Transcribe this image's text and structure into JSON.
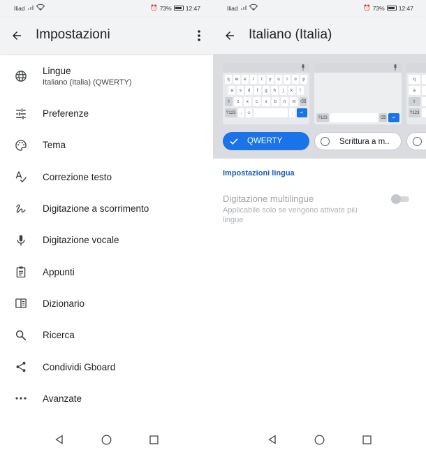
{
  "status_bar": {
    "carrier": "Iliad",
    "battery": "73%",
    "time": "12:47"
  },
  "left_screen": {
    "title": "Impostazioni",
    "menu": [
      {
        "label": "Lingue",
        "sub": "Italiano (Italia) (QWERTY)",
        "icon": "globe-icon"
      },
      {
        "label": "Preferenze",
        "icon": "sliders-icon"
      },
      {
        "label": "Tema",
        "icon": "palette-icon"
      },
      {
        "label": "Correzione testo",
        "icon": "spellcheck-icon"
      },
      {
        "label": "Digitazione a scorrimento",
        "icon": "gesture-icon"
      },
      {
        "label": "Digitazione vocale",
        "icon": "mic-icon"
      },
      {
        "label": "Appunti",
        "icon": "clipboard-icon"
      },
      {
        "label": "Dizionario",
        "icon": "dictionary-icon"
      },
      {
        "label": "Ricerca",
        "icon": "search-icon"
      },
      {
        "label": "Condividi Gboard",
        "icon": "share-icon"
      },
      {
        "label": "Avanzate",
        "icon": "more-horizontal-icon"
      }
    ]
  },
  "right_screen": {
    "title": "Italiano (Italia)",
    "layouts": [
      {
        "label": "QWERTY",
        "selected": true
      },
      {
        "label": "Scrittura a m..",
        "selected": false
      }
    ],
    "keyboard_preview": {
      "row1": [
        "q",
        "w",
        "e",
        "r",
        "t",
        "y",
        "u",
        "i",
        "o",
        "p"
      ],
      "row2": [
        "a",
        "s",
        "d",
        "f",
        "g",
        "h",
        "j",
        "k",
        "l"
      ],
      "row3": [
        "⇧",
        "z",
        "x",
        "c",
        "v",
        "b",
        "n",
        "m",
        "⌫"
      ],
      "row4_left": "?123",
      "row4_comma": ",",
      "row4_dot": ".",
      "enter": "↵"
    },
    "handwriting_preview": {
      "symbols_key": "?123",
      "enter": "↵"
    },
    "section_title": "Impostazioni lingua",
    "multilingual": {
      "title": "Digitazione multilingue",
      "subtitle": "Applicabile solo se vengono attivate più lingue",
      "enabled": false
    }
  },
  "colors": {
    "accent": "#1a73e8",
    "section_title": "#1a5fb4",
    "app_bar": "#f1f3f4"
  }
}
